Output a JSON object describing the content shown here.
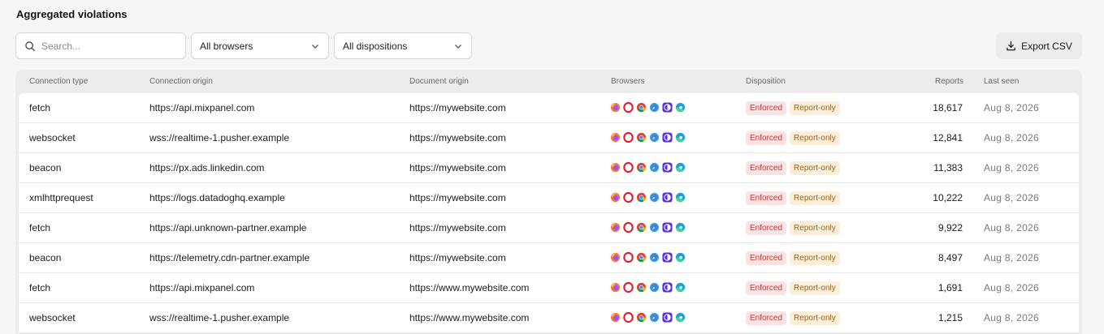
{
  "page": {
    "title": "Aggregated violations"
  },
  "toolbar": {
    "search_placeholder": "Search...",
    "browser_filter": "All browsers",
    "disposition_filter": "All dispositions",
    "export_label": "Export CSV"
  },
  "table": {
    "columns": [
      "Connection type",
      "Connection origin",
      "Document origin",
      "Browsers",
      "Disposition",
      "Reports",
      "Last seen"
    ],
    "browser_icons": [
      "firefox-icon",
      "opera-icon",
      "chrome-icon",
      "safari-icon",
      "tor-icon",
      "edge-icon"
    ],
    "rows": [
      {
        "type": "fetch",
        "conn": "https://api.mixpanel.com",
        "doc": "https://mywebsite.com",
        "enforced": "Enforced",
        "report_only": "Report-only",
        "reports": "18,617",
        "seen": "Aug 8, 2026"
      },
      {
        "type": "websocket",
        "conn": "wss://realtime-1.pusher.example",
        "doc": "https://mywebsite.com",
        "enforced": "Enforced",
        "report_only": "Report-only",
        "reports": "12,841",
        "seen": "Aug 8, 2026"
      },
      {
        "type": "beacon",
        "conn": "https://px.ads.linkedin.com",
        "doc": "https://mywebsite.com",
        "enforced": "Enforced",
        "report_only": "Report-only",
        "reports": "11,383",
        "seen": "Aug 8, 2026"
      },
      {
        "type": "xmlhttprequest",
        "conn": "https://logs.datadoghq.example",
        "doc": "https://mywebsite.com",
        "enforced": "Enforced",
        "report_only": "Report-only",
        "reports": "10,222",
        "seen": "Aug 8, 2026"
      },
      {
        "type": "fetch",
        "conn": "https://api.unknown-partner.example",
        "doc": "https://mywebsite.com",
        "enforced": "Enforced",
        "report_only": "Report-only",
        "reports": "9,922",
        "seen": "Aug 8, 2026"
      },
      {
        "type": "beacon",
        "conn": "https://telemetry.cdn-partner.example",
        "doc": "https://mywebsite.com",
        "enforced": "Enforced",
        "report_only": "Report-only",
        "reports": "8,497",
        "seen": "Aug 8, 2026"
      },
      {
        "type": "fetch",
        "conn": "https://api.mixpanel.com",
        "doc": "https://www.mywebsite.com",
        "enforced": "Enforced",
        "report_only": "Report-only",
        "reports": "1,691",
        "seen": "Aug 8, 2026"
      },
      {
        "type": "websocket",
        "conn": "wss://realtime-1.pusher.example",
        "doc": "https://www.mywebsite.com",
        "enforced": "Enforced",
        "report_only": "Report-only",
        "reports": "1,215",
        "seen": "Aug 8, 2026"
      }
    ]
  },
  "colors": {
    "enforced_bg": "#fbe3e3",
    "enforced_fg": "#b53a3a",
    "report_bg": "#fbefdc",
    "report_fg": "#97641e"
  }
}
